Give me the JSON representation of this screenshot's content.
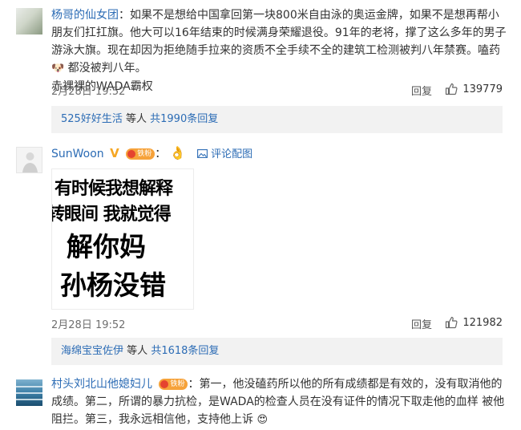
{
  "comments": [
    {
      "username": "杨哥的仙女团",
      "text": "如果不是想给中国拿回第一块800米自由泳的奥运金牌，如果不是想再帮小朋友们扛扛旗。他大可以16年结束的时候满身荣耀退役。91年的老将，撑了这么多年的男子游泳大旗。现在却因为拒绝随手拉来的资质不全手续不全的建筑工检测被判八年禁赛。嗑药",
      "text_tail": "都没被判八年。",
      "text_line4": "赤裸裸的WADA霸权",
      "time": "2月28日 19:52",
      "reply_label": "回复",
      "likes": "139779",
      "sub": {
        "user": "525好好生活",
        "middle": "等人",
        "link": "共1990条回复"
      }
    },
    {
      "username": "SunWoon",
      "badge": "铁粉",
      "emoji": "👌",
      "photo_link": "评论配图",
      "image_text": [
        "有时候我想解释",
        "转眼间 我就觉得",
        "解你妈",
        "孙杨没错"
      ],
      "time": "2月28日 19:52",
      "reply_label": "回复",
      "likes": "121982",
      "sub": {
        "user": "海绵宝宝佐伊",
        "middle": "等人",
        "link": "共1618条回复"
      }
    },
    {
      "username": "村头刘北山他媳妇儿",
      "badge": "铁粉",
      "text": "第一，他没磕药所以他的所有成绩都是有效的，没有取消他的成绩。第二，所谓的暴力抗检，是WADA的检查人员在没有证件的情况下取走他的血样 被他阻拦。第三，我永远相信他，支持他上诉",
      "emoji": "😍"
    }
  ],
  "separator": "：",
  "icons": {
    "like": "thumbs-up-icon",
    "photo": "image-icon",
    "verified": "verified-v-icon",
    "fan_badge": "heart-badge-icon"
  },
  "colors": {
    "link": "#2c6cb5",
    "badge": "#f6a23a",
    "subbox": "#f2f2f2"
  }
}
